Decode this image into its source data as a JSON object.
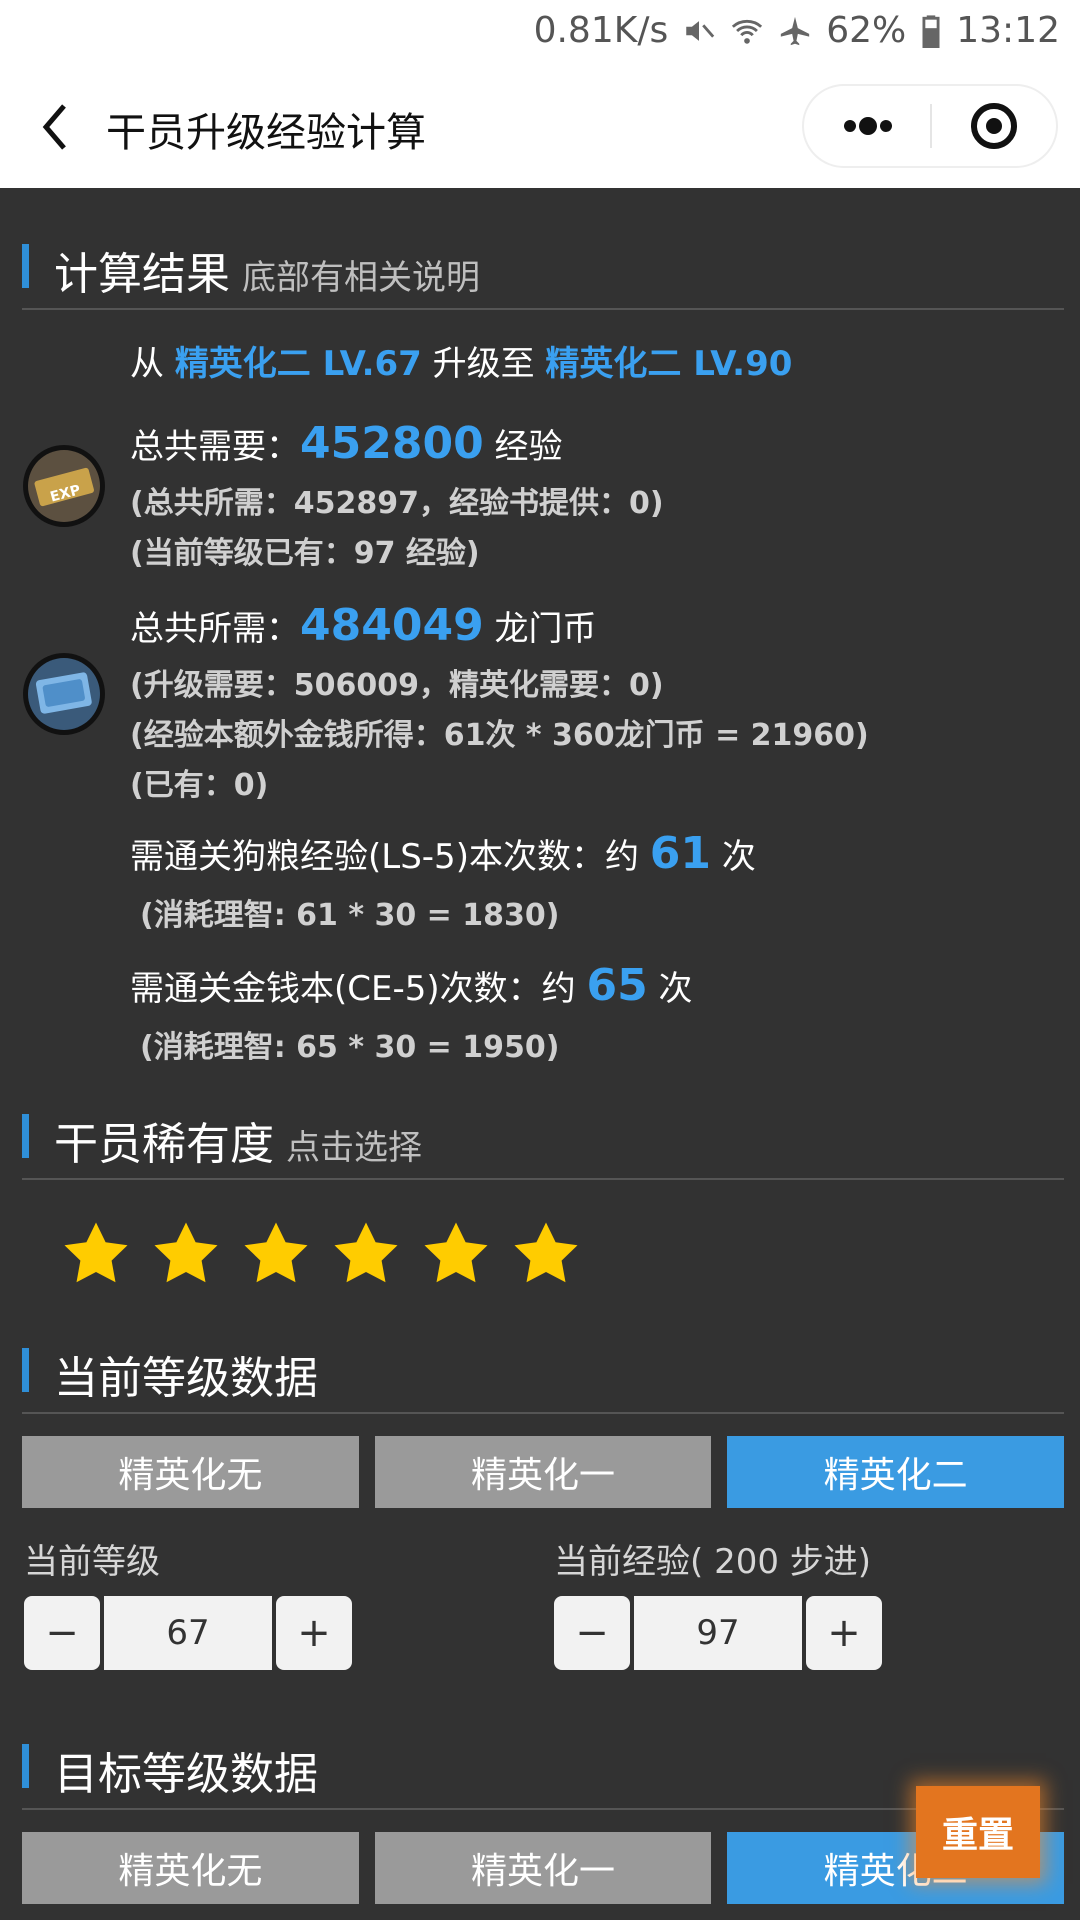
{
  "status_bar": {
    "speed": "0.81K/s",
    "battery": "62%",
    "time": "13:12"
  },
  "nav": {
    "title": "干员升级经验计算"
  },
  "result": {
    "heading": "计算结果",
    "subheading": "底部有相关说明",
    "from_prefix": "从",
    "from_value": "精英化二 LV.67",
    "to_prefix": "升级至",
    "to_value": "精英化二 LV.90",
    "exp_label": "总共需要：",
    "exp_value": "452800",
    "exp_unit": "经验",
    "exp_note1": "(总共所需：452897，经验书提供：0)",
    "exp_note2": "(当前等级已有：97 经验)",
    "coin_label": "总共所需：",
    "coin_value": "484049",
    "coin_unit": "龙门币",
    "coin_note1": "(升级需要：506009，精英化需要：0)",
    "coin_note2": "(经验本额外金钱所得：61次 * 360龙门币 = 21960)",
    "coin_note3": "(已有：0)",
    "ls_label": "需通关狗粮经验(LS-5)本次数：约",
    "ls_value": "61",
    "ls_unit": "次",
    "ls_note": "(消耗理智: 61 * 30 = 1830)",
    "ce_label": "需通关金钱本(CE-5)次数：约",
    "ce_value": "65",
    "ce_unit": "次",
    "ce_note": "(消耗理智: 65 * 30 = 1950)"
  },
  "rarity": {
    "heading": "干员稀有度",
    "subheading": "点击选择",
    "stars": 6
  },
  "current": {
    "heading": "当前等级数据",
    "elite_options": [
      "精英化无",
      "精英化一",
      "精英化二"
    ],
    "selected_elite": 2,
    "level_label": "当前等级",
    "level_value": "67",
    "exp_label": "当前经验( 200 步进)",
    "exp_value": "97",
    "minus": "−",
    "plus": "+"
  },
  "target": {
    "heading": "目标等级数据",
    "elite_options": [
      "精英化无",
      "精英化一",
      "精英化二"
    ],
    "selected_elite": 2
  },
  "reset_label": "重置",
  "colors": {
    "accent": "#3a9be2",
    "reset": "#e3751f",
    "background": "#323232"
  }
}
